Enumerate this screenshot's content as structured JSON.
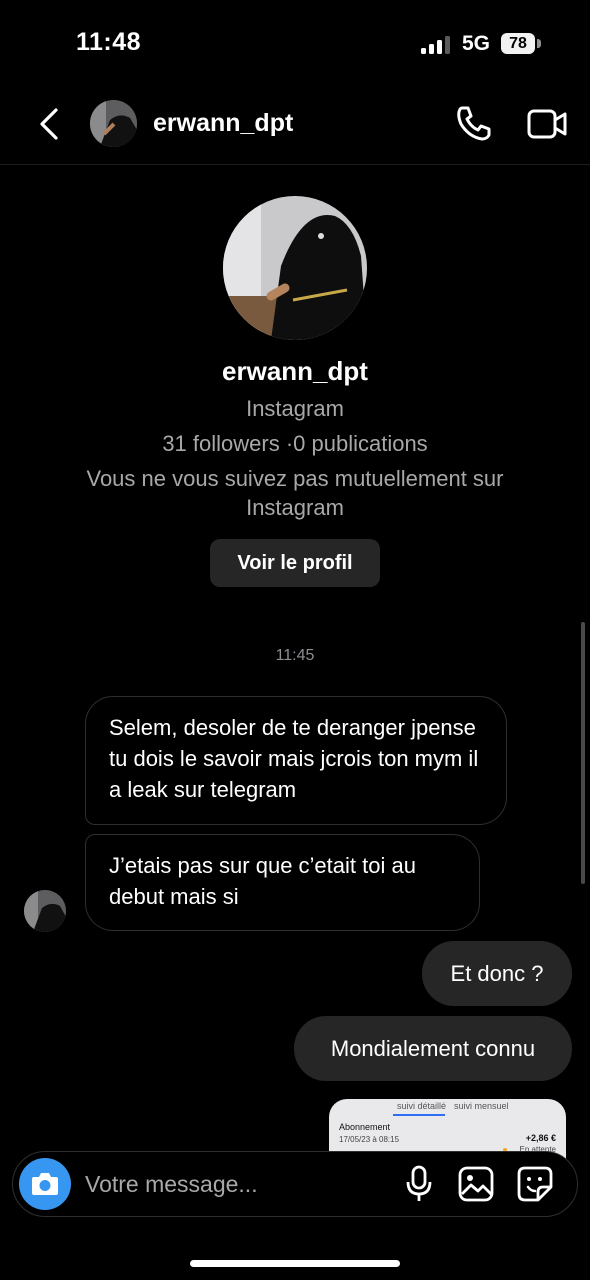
{
  "status_bar": {
    "time": "11:48",
    "network": "5G",
    "battery": "78"
  },
  "header": {
    "username": "erwann_dpt"
  },
  "profile": {
    "username": "erwann_dpt",
    "platform": "Instagram",
    "stats": "31 followers ·0 publications",
    "mutual_note": "Vous ne vous suivez pas mutuellement sur Instagram",
    "view_profile_label": "Voir le profil"
  },
  "thread": {
    "timestamp": "11:45",
    "incoming": [
      "Selem, desoler de te deranger jpense tu dois le savoir mais jcrois ton mym il a leak sur telegram",
      "J’etais pas sur que c’etait toi au debut mais si"
    ],
    "outgoing": [
      "Et donc ?",
      "Mondialement connu"
    ],
    "shared_image": {
      "tab_left": "suivi détaillé",
      "tab_right": "suivi mensuel",
      "title": "Abonnement",
      "date": "17/05/23 à 08:15",
      "amount": "+2,86 €",
      "status": "En attente"
    }
  },
  "composer": {
    "placeholder": "Votre message..."
  },
  "colors": {
    "accent": "#3797f0",
    "bubble_out": "#262626",
    "bubble_in_border": "#2f2f2f",
    "muted_text": "#a8a8a8"
  }
}
